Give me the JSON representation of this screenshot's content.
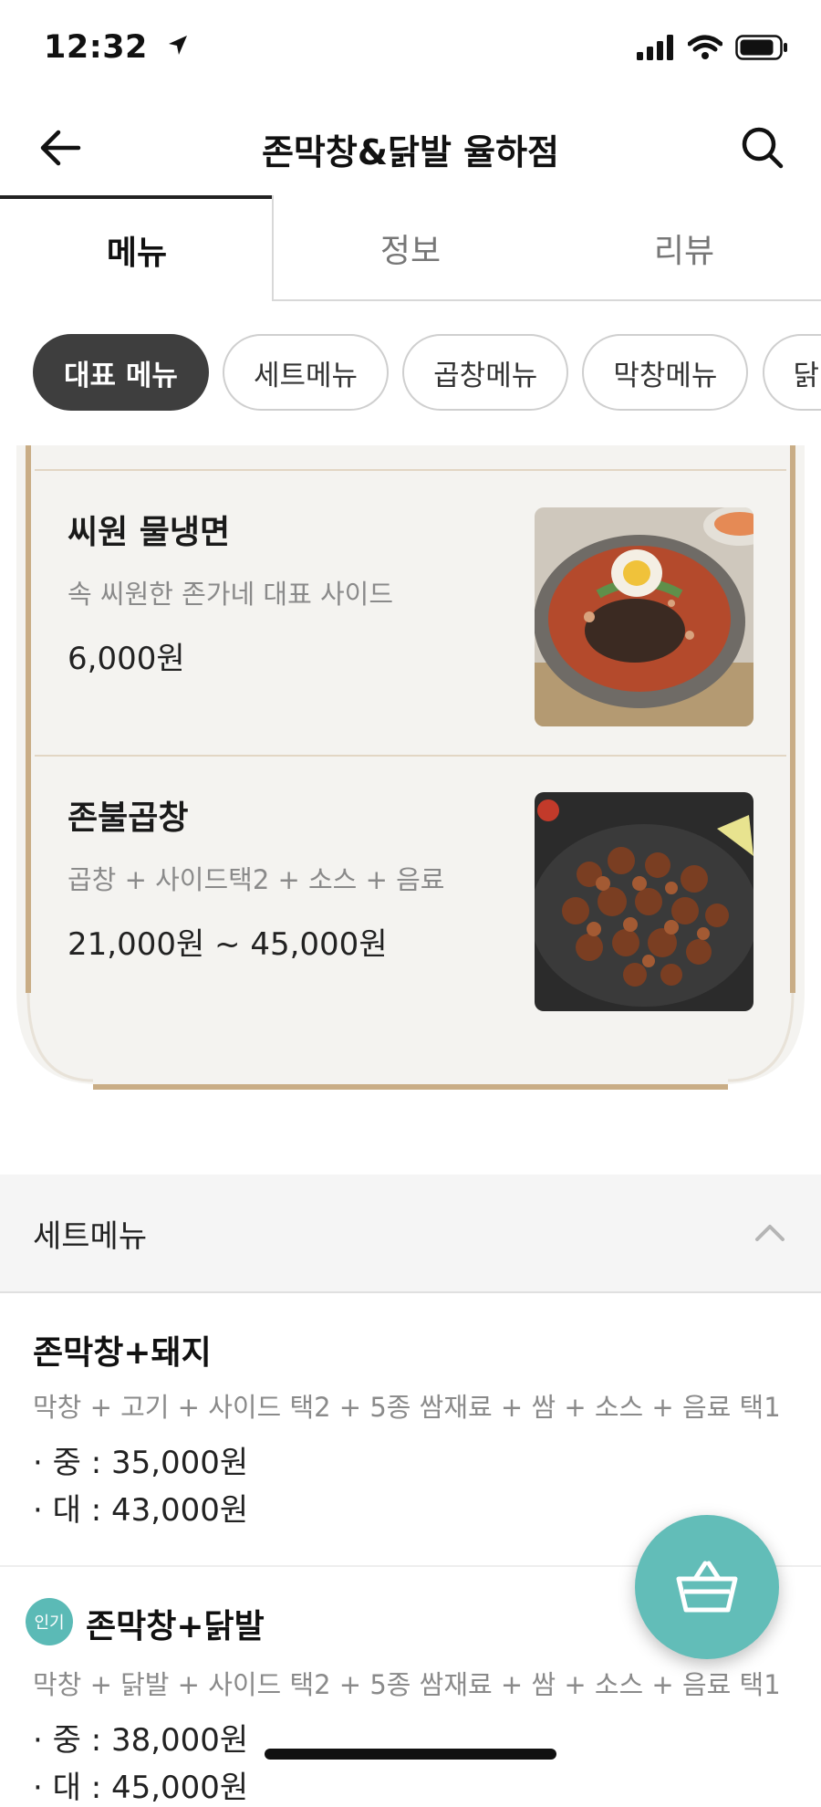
{
  "status": {
    "time": "12:32"
  },
  "header": {
    "title": "존막창&닭발 율하점"
  },
  "tabs": [
    {
      "label": "메뉴"
    },
    {
      "label": "정보"
    },
    {
      "label": "리뷰"
    }
  ],
  "categories": [
    "대표 메뉴",
    "세트메뉴",
    "곱창메뉴",
    "막창메뉴",
    "닭발메뉴"
  ],
  "featured": [
    {
      "name": "씨원 물냉면",
      "description": "속 씨원한 존가네 대표 사이드",
      "price": "6,000원"
    },
    {
      "name": "존불곱창",
      "description": "곱창 + 사이드택2 + 소스 + 음료",
      "price": "21,000원 ~ 45,000원"
    }
  ],
  "set_section": {
    "title": "세트메뉴",
    "items": [
      {
        "name": "존막창+돼지",
        "description": "막창 + 고기 + 사이드 택2 + 5종 쌈재료 + 쌈 + 소스 + 음료 택1",
        "prices": [
          "· 중 : 35,000원",
          "· 대 : 43,000원"
        ]
      },
      {
        "badge": "인기",
        "name": "존막창+닭발",
        "description": "막창 + 닭발 + 사이드 택2 + 5종 쌈재료 + 쌈 + 소스 + 음료 택1",
        "prices": [
          "· 중 : 38,000원",
          "· 대 : 45,000원"
        ]
      }
    ]
  },
  "colors": {
    "accent": "#62bdb8",
    "card_border": "#c9ad86",
    "chip_selected": "#3e3e3e"
  }
}
